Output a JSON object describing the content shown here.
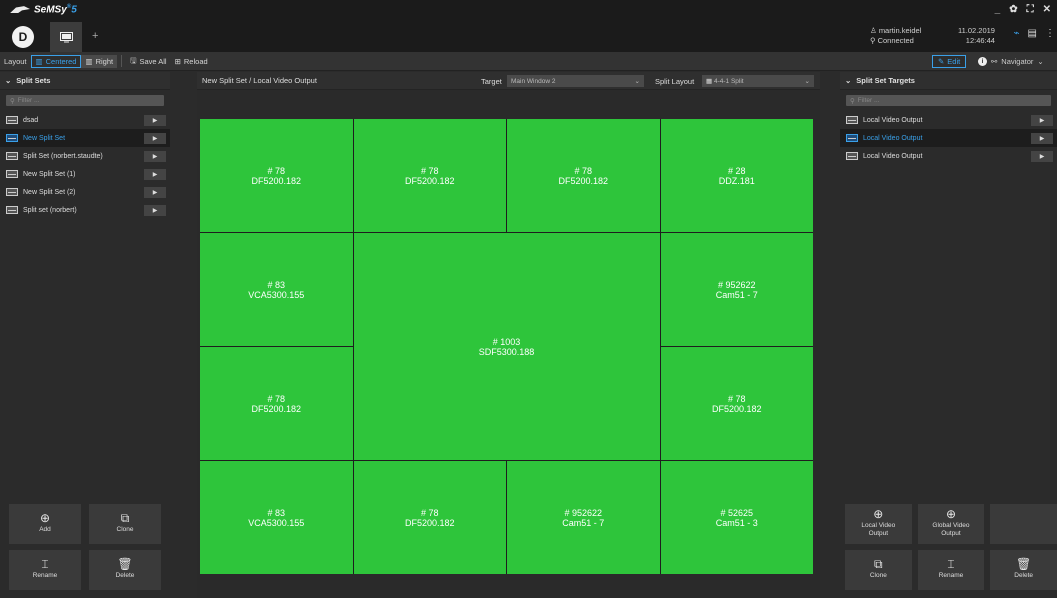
{
  "app": {
    "brand": "SeMSy",
    "version": "5"
  },
  "user": {
    "name": "martin.keidel",
    "status": "Connected"
  },
  "clock": {
    "date": "11.02.2019",
    "time": "12:46:44"
  },
  "toolbar": {
    "layout_label": "Layout",
    "centered_label": "Centered",
    "right_label": "Right",
    "save_all_label": "Save All",
    "reload_label": "Reload",
    "edit_label": "Edit",
    "navigator_label": "Navigator"
  },
  "left_panel": {
    "title": "Split Sets",
    "filter_placeholder": "Filter ...",
    "items": [
      {
        "label": "dsad",
        "selected": false
      },
      {
        "label": "New Split Set",
        "selected": true
      },
      {
        "label": "Split Set (norbert.staudte)",
        "selected": false
      },
      {
        "label": "New Split Set (1)",
        "selected": false
      },
      {
        "label": "New Split Set (2)",
        "selected": false
      },
      {
        "label": "Split set (norbert)",
        "selected": false
      }
    ],
    "actions": {
      "add": "Add",
      "clone": "Clone",
      "rename": "Rename",
      "delete": "Delete"
    }
  },
  "center": {
    "breadcrumb": "New Split Set / Local Video Output",
    "target_label": "Target",
    "target_value": "Main Window 2",
    "split_layout_label": "Split Layout",
    "split_layout_value": "4-4-1 Split",
    "tiles": [
      {
        "num": "# 78",
        "name": "DF5200.182"
      },
      {
        "num": "# 78",
        "name": "DF5200.182"
      },
      {
        "num": "# 78",
        "name": "DF5200.182"
      },
      {
        "num": "# 28",
        "name": "DDZ.181"
      },
      {
        "num": "# 83",
        "name": "VCA5300.155"
      },
      {
        "num": "# 1003",
        "name": "SDF5300.188"
      },
      {
        "num": "# 952622",
        "name": "Cam51 - 7"
      },
      {
        "num": "# 78",
        "name": "DF5200.182"
      },
      {
        "num": "# 78",
        "name": "DF5200.182"
      },
      {
        "num": "# 83",
        "name": "VCA5300.155"
      },
      {
        "num": "# 78",
        "name": "DF5200.182"
      },
      {
        "num": "# 952622",
        "name": "Cam51 - 7"
      },
      {
        "num": "# 52625",
        "name": "Cam51 - 3"
      }
    ]
  },
  "right_panel": {
    "title": "Split Set Targets",
    "filter_placeholder": "Filter ...",
    "items": [
      {
        "label": "Local Video Output",
        "selected": false
      },
      {
        "label": "Local Video Output",
        "selected": true
      },
      {
        "label": "Local Video Output",
        "selected": false
      }
    ],
    "actions": {
      "local_video_output": "Local Video Output",
      "global_video_output": "Global Video Output",
      "clone": "Clone",
      "rename": "Rename",
      "delete": "Delete"
    }
  },
  "colors": {
    "accent": "#3aa0e8",
    "tile": "#2ec53b"
  }
}
